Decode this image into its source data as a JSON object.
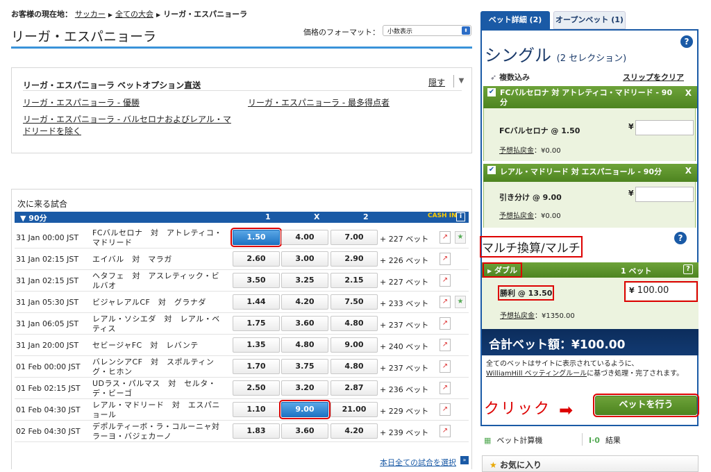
{
  "breadcrumb": {
    "prefix": "お客様の現在地：",
    "items": [
      "サッカー",
      "全ての大会"
    ],
    "current": "リーガ・エスパニョーラ"
  },
  "page_title": "リーガ・エスパニョーラ",
  "price_format": {
    "label": "価格のフォーマット：",
    "selected": "小数表示"
  },
  "options_panel": {
    "heading": "リーガ・エスパニョーラ ベットオプション直送",
    "hide_label": "隠す",
    "links": [
      "リーガ・エスパニョーラ - 優勝",
      "リーガ・エスパニョーラ - 最多得点者",
      "リーガ・エスパニョーラ - バルセロナおよびレアル・マドリードを除く"
    ]
  },
  "matches": {
    "section_title": "次に来る試合",
    "header": {
      "period": "▼ 90分",
      "col1": "1",
      "colx": "X",
      "col2": "2",
      "cashin": "CASH IN",
      "info": "i"
    },
    "rows": [
      {
        "date": "31 Jan   00:00 JST",
        "match": "FCバルセロナ　対　アトレティコ・マドリード",
        "o1": "1.50",
        "ox": "4.00",
        "o2": "7.00",
        "bets": "+ 227 ベット",
        "sel": "1",
        "fav": true
      },
      {
        "date": "31 Jan   02:15 JST",
        "match": "エイバル　対　マラガ",
        "o1": "2.60",
        "ox": "3.00",
        "o2": "2.90",
        "bets": "+ 226 ベット"
      },
      {
        "date": "31 Jan   02:15 JST",
        "match": "ヘタフェ　対　アスレティック・ビルバオ",
        "o1": "3.50",
        "ox": "3.25",
        "o2": "2.15",
        "bets": "+ 227 ベット"
      },
      {
        "date": "31 Jan   05:30 JST",
        "match": "ビジャレアルCF　対　グラナダ",
        "o1": "1.44",
        "ox": "4.20",
        "o2": "7.50",
        "bets": "+ 233 ベット",
        "fav": true
      },
      {
        "date": "31 Jan   06:05 JST",
        "match": "レアル・ソシエダ　対　レアル・ベティス",
        "o1": "1.75",
        "ox": "3.60",
        "o2": "4.80",
        "bets": "+ 237 ベット"
      },
      {
        "date": "31 Jan   20:00 JST",
        "match": "セビージャFC　対　レバンテ",
        "o1": "1.35",
        "ox": "4.80",
        "o2": "9.00",
        "bets": "+ 240 ベット"
      },
      {
        "date": "01 Feb   00:00 JST",
        "match": "バレンシアCF　対　スポルティング・ヒホン",
        "o1": "1.70",
        "ox": "3.75",
        "o2": "4.80",
        "bets": "+ 237 ベット"
      },
      {
        "date": "01 Feb   02:15 JST",
        "match": "UDラス・パルマス　対　セルタ・デ・ビーゴ",
        "o1": "2.50",
        "ox": "3.20",
        "o2": "2.87",
        "bets": "+ 236 ベット"
      },
      {
        "date": "01 Feb   04:30 JST",
        "match": "レアル・マドリード　対　エスパニョール",
        "o1": "1.10",
        "ox": "9.00",
        "o2": "21.00",
        "bets": "+ 229 ベット",
        "sel": "x"
      },
      {
        "date": "02 Feb   04:30 JST",
        "match": "デポルティーボ・ラ・コルーニャ対　ラーヨ・バジェカーノ",
        "o1": "1.83",
        "ox": "3.60",
        "o2": "4.20",
        "bets": "+ 239 ベット"
      }
    ],
    "today_link": "本日全ての試合を選択"
  },
  "slip": {
    "tab_details": "ベット詳細 (2)",
    "tab_open": "オープンベット (1)",
    "title": "シングル",
    "count": "(2 セレクション)",
    "multi_label": "複数込み",
    "clear_label": "スリップをクリア",
    "bets": [
      {
        "event": "FCバルセロナ 対 アトレティコ・マドリード - 90分",
        "selection": "FCバルセロナ @ 1.50",
        "yen": "¥",
        "return_label": "予想払戻金",
        "return_value": "：¥0.00"
      },
      {
        "event": "レアル・マドリード 対 エスパニョール - 90分",
        "selection": "引き分け @ 9.00",
        "yen": "¥",
        "return_label": "予想払戻金",
        "return_value": "：¥0.00"
      }
    ],
    "multi_title": "マルチ換算/マルチ",
    "double": {
      "label": "ダブル",
      "bets_label": "1 ベット",
      "help": "?",
      "selection": "勝利 @ 13.50",
      "yen": "¥",
      "stake": "100.00",
      "return_label": "予想払戻金",
      "return_value": "：¥1350.00"
    },
    "total": "合計ベット額：¥100.00",
    "note_1": "全てのベットはサイトに表示されているように、",
    "note_link": "WilliamHill ベッティングルール",
    "note_2": "に基づき処理・完了されます。",
    "click_text": "クリック",
    "place_button": "ベットを行う",
    "calc_label": "ベット計算機",
    "results_label": "結果",
    "favorites_label": "お気に入り"
  }
}
